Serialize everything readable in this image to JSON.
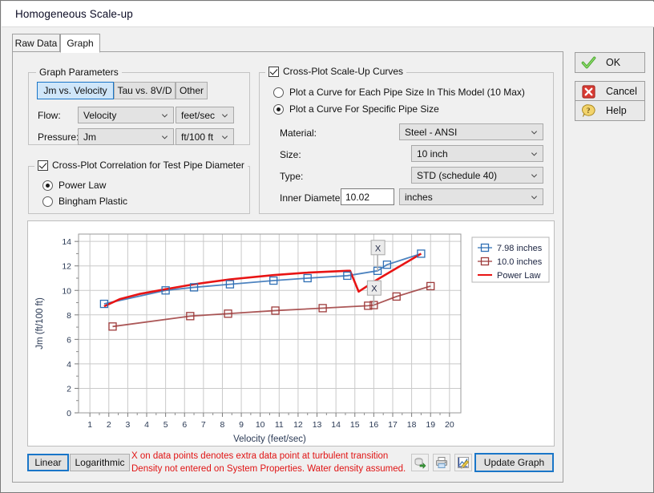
{
  "window": {
    "title": "Homogeneous Scale-up"
  },
  "tabs": [
    {
      "id": "raw-data",
      "label": "Raw Data",
      "selected": false
    },
    {
      "id": "graph",
      "label": "Graph",
      "selected": true
    }
  ],
  "graph_parameters": {
    "legend": "Graph Parameters",
    "mode_buttons": [
      {
        "label": "Jm vs. Velocity",
        "selected": true
      },
      {
        "label": "Tau vs. 8V/D",
        "selected": false
      },
      {
        "label": "Other",
        "selected": false
      }
    ],
    "flow_label": "Flow:",
    "flow_value": "Velocity",
    "flow_units": "feet/sec",
    "pressure_label": "Pressure:",
    "pressure_value": "Jm",
    "pressure_units": "ft/100 ft"
  },
  "cross_plot_correlation": {
    "legend": "Cross-Plot Correlation for Test Pipe Diameter",
    "checked": true,
    "options": [
      {
        "label": "Power Law",
        "selected": true
      },
      {
        "label": "Bingham Plastic",
        "selected": false
      }
    ]
  },
  "cross_plot_scaleup": {
    "legend": "Cross-Plot Scale-Up Curves",
    "checked": true,
    "options": [
      {
        "label": "Plot a Curve for Each Pipe Size In This Model (10 Max)",
        "selected": false
      },
      {
        "label": "Plot a Curve For Specific Pipe Size",
        "selected": true
      }
    ],
    "material_label": "Material:",
    "material_value": "Steel - ANSI",
    "size_label": "Size:",
    "size_value": "10 inch",
    "type_label": "Type:",
    "type_value": "STD (schedule 40)",
    "inner_diameter_label": "Inner Diameter:",
    "inner_diameter_value": "10.02",
    "inner_diameter_units": "inches"
  },
  "bottom_bar": {
    "scale_buttons": [
      {
        "label": "Linear",
        "selected": true
      },
      {
        "label": "Logarithmic",
        "selected": false
      }
    ],
    "warning_line1": "X on data points denotes extra data point at turbulent transition",
    "warning_line2": "Density not entered on System Properties. Water density assumed.",
    "warning_color": "#e01414",
    "icons": [
      {
        "name": "export-icon",
        "enabled": false
      },
      {
        "name": "print-icon",
        "enabled": false
      },
      {
        "name": "edit-chart-icon",
        "enabled": true
      }
    ],
    "update_button": "Update Graph"
  },
  "right_buttons": [
    {
      "id": "ok",
      "label": "OK",
      "icon": "check-icon"
    },
    {
      "id": "cancel",
      "label": "Cancel",
      "icon": "cross-icon"
    },
    {
      "id": "help",
      "label": "Help",
      "icon": "question-icon"
    }
  ],
  "chart_data": {
    "type": "line",
    "title": "",
    "xlabel": "Velocity (feet/sec)",
    "ylabel": "Jm (ft/100 ft)",
    "xlim": [
      0.4,
      20.6
    ],
    "ylim": [
      0,
      14.6
    ],
    "xticks": [
      1,
      2,
      3,
      4,
      5,
      6,
      7,
      8,
      9,
      10,
      11,
      12,
      13,
      14,
      15,
      16,
      17,
      18,
      19,
      20
    ],
    "yticks": [
      0,
      2,
      4,
      6,
      8,
      10,
      12,
      14
    ],
    "grid": true,
    "legend_position": "top-right",
    "legend_entries": [
      "7.98 inches",
      "10.0 inches",
      "Power Law"
    ],
    "colors": {
      "series1": "#2f6fb5",
      "series2": "#9e3b3b",
      "power_law": "#e81414"
    },
    "series": [
      {
        "name": "7.98 inches",
        "color": "#2f6fb5",
        "marker": "square-open",
        "x": [
          1.75,
          5.0,
          6.5,
          8.4,
          10.7,
          12.5,
          14.6,
          16.2,
          16.7,
          18.5
        ],
        "y": [
          8.9,
          10.0,
          10.25,
          10.5,
          10.8,
          11.0,
          11.2,
          11.6,
          12.1,
          13.0
        ]
      },
      {
        "name": "10.0 inches",
        "color": "#9e3b3b",
        "marker": "square-open",
        "x": [
          2.2,
          6.3,
          8.3,
          10.8,
          13.3,
          15.7,
          16.0,
          17.2,
          19.0
        ],
        "y": [
          7.05,
          7.9,
          8.1,
          8.35,
          8.55,
          8.75,
          8.8,
          9.5,
          10.35
        ]
      },
      {
        "name": "Power Law",
        "color": "#e81414",
        "marker": "none",
        "x": [
          1.75,
          2.6,
          3.6,
          5.0,
          6.5,
          8.4,
          10.7,
          12.5,
          14.6,
          14.75,
          15.2,
          16.2,
          18.5
        ],
        "y": [
          8.7,
          9.3,
          9.7,
          10.1,
          10.5,
          10.9,
          11.25,
          11.45,
          11.6,
          11.6,
          9.9,
          10.9,
          13.0
        ]
      }
    ],
    "annotations": [
      {
        "label": "X",
        "x": 16.2,
        "y": 13.5,
        "anchor_x": 16.2,
        "anchor_y": 11.6
      },
      {
        "label": "X",
        "x": 16.0,
        "y": 10.2,
        "anchor_x": 16.0,
        "anchor_y": 8.8
      }
    ]
  }
}
